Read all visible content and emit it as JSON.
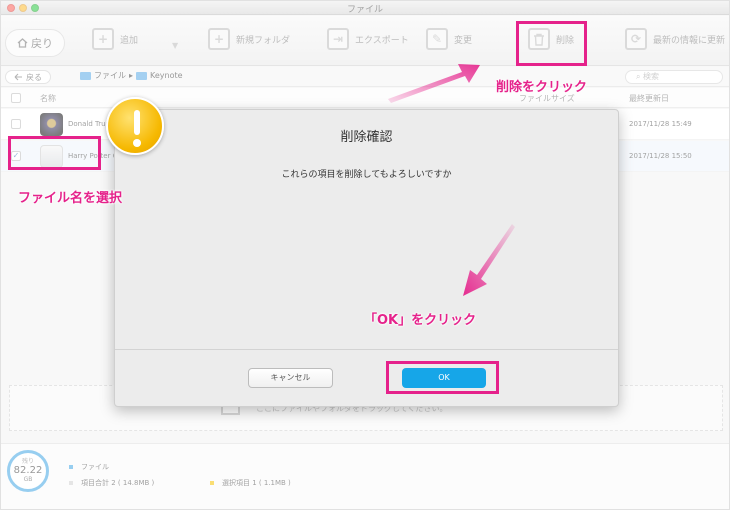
{
  "window": {
    "title": "ファイル"
  },
  "toolbar": {
    "back_label": "戻り",
    "add_label": "追加",
    "new_folder_label": "新規フォルダ",
    "export_label": "エクスポート",
    "rename_label": "変更",
    "delete_label": "削除",
    "refresh_label": "最新の情報に更新"
  },
  "pathbar": {
    "back_label": "戻る",
    "crumb_root": "ファイル",
    "crumb_folder": "Keynote",
    "search_placeholder": "検索"
  },
  "list": {
    "columns": {
      "name": "名称",
      "size": "ファイルサイズ",
      "modified": "最終更新日"
    },
    "rows": [
      {
        "name": "Donald Trump",
        "modified": "2017/11/28  15:49",
        "checked": false
      },
      {
        "name": "Harry Potter 6",
        "modified": "2017/11/28  15:50",
        "checked": true
      }
    ]
  },
  "dropzone": {
    "text": "ここにファイルやフォルダをドラッグしてください。"
  },
  "footer": {
    "gauge_label": "残り",
    "gauge_value": "82.22",
    "gauge_unit": "GB",
    "files_label": "ファイル",
    "total_label": "項目合計 2 ( 14.8MB )",
    "selected_label": "選択項目 1 ( 1.1MB )",
    "files_color": "#43a6e4",
    "total_color": "#cfcfcf",
    "selected_color": "#f6c400"
  },
  "dialog": {
    "title": "削除確認",
    "message": "これらの項目を削除してもよろしいですか",
    "cancel_label": "キャンセル",
    "ok_label": "OK"
  },
  "annotations": {
    "delete_click": "削除をクリック",
    "select_file": "ファイル名を選択",
    "ok_click": "「OK」をクリック",
    "color": "#e5228b"
  }
}
